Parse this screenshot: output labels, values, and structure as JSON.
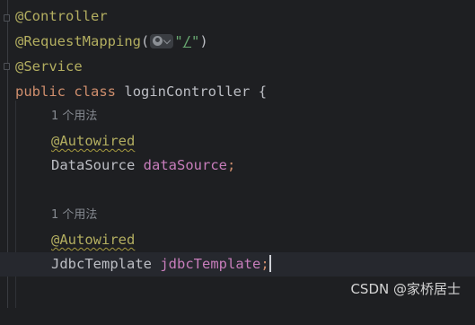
{
  "code": {
    "line1": {
      "annotation": "@Controller"
    },
    "line2": {
      "annotation": "@RequestMapping",
      "open_paren": "(",
      "quote_open": "\"",
      "path": "/",
      "quote_close": "\"",
      "close_paren": ")"
    },
    "line3": {
      "annotation": "@Service"
    },
    "line4": {
      "kw_public": "public",
      "kw_class": "class",
      "class_name": "loginController",
      "brace": "{"
    },
    "usage_hint_1": "1 个用法",
    "field1": {
      "annotation": "@Autowired",
      "type": "DataSource",
      "name": "dataSource",
      "semicolon": ";"
    },
    "usage_hint_2": "1 个用法",
    "field2": {
      "annotation": "@Autowired",
      "type": "JdbcTemplate",
      "name": "jdbcTemplate",
      "semicolon": ";"
    }
  },
  "icons": {
    "request_mapping_chip": "globe-dropdown-icon"
  },
  "watermark": "CSDN @家桥居士",
  "colors": {
    "background": "#1e1f22",
    "annotation": "#b3ae60",
    "keyword": "#cf8e6d",
    "field": "#c77dbb",
    "string": "#6aab73",
    "hint": "#868a91"
  }
}
